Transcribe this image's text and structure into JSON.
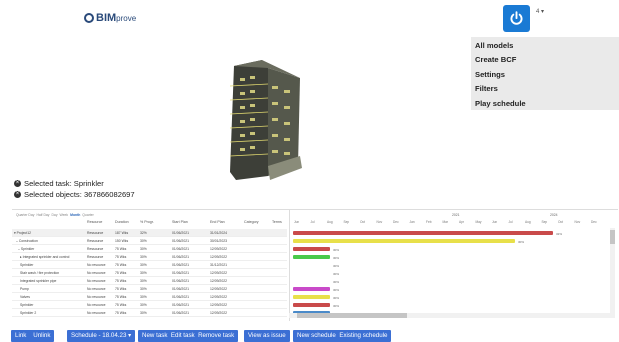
{
  "header": {
    "logo_main": "BIM",
    "logo_sub": "prove",
    "user_caret": "4 ▾"
  },
  "side_menu": {
    "items": [
      "All models",
      "Create BCF",
      "Settings",
      "Filters",
      "Play schedule"
    ]
  },
  "selection": {
    "task_label": "Selected task: Sprinkler",
    "objects_label": "Selected objects: 367866082697"
  },
  "gantt": {
    "view_modes": [
      "Quarter Day",
      "Half Day",
      "Day",
      "Week",
      "Month",
      "Quarter"
    ],
    "active_view": "Month",
    "columns": [
      "Resource",
      "Duration",
      "% Progr.",
      "Start Plan",
      "End Plan",
      "Category",
      "Terms"
    ],
    "rows": [
      {
        "name": "▾ Project12",
        "resource": "Ressource",
        "duration": "187 Wks",
        "progress": "32%",
        "start": "01/06/2021",
        "end": "31/01/2024"
      },
      {
        "name": "– Construction",
        "resource": "Ressource",
        "duration": "150 Wks",
        "progress": "30%",
        "start": "01/06/2021",
        "end": "30/01/2023"
      },
      {
        "name": "– Sprinkler",
        "resource": "Ressource",
        "duration": "75 Wks",
        "progress": "30%",
        "start": "01/06/2021",
        "end": "12/09/2022"
      },
      {
        "name": "▸ Integrated sprinkler and control",
        "resource": "Ressource",
        "duration": "75 Wks",
        "progress": "30%",
        "start": "01/06/2021",
        "end": "12/09/2022"
      },
      {
        "name": "Sprinkler",
        "resource": "No resource",
        "duration": "75 Wks",
        "progress": "30%",
        "start": "01/06/2021",
        "end": "31/12/2021"
      },
      {
        "name": "Stair wash / fire protection",
        "resource": "No resource",
        "duration": "75 Wks",
        "progress": "30%",
        "start": "01/06/2021",
        "end": "12/09/2022"
      },
      {
        "name": "Integrated sprinkler pipe",
        "resource": "No resource",
        "duration": "75 Wks",
        "progress": "30%",
        "start": "01/06/2021",
        "end": "12/09/2022"
      },
      {
        "name": "Pump",
        "resource": "No resource",
        "duration": "75 Wks",
        "progress": "30%",
        "start": "01/06/2021",
        "end": "12/09/2022"
      },
      {
        "name": "Valves",
        "resource": "No resource",
        "duration": "75 Wks",
        "progress": "30%",
        "start": "01/06/2021",
        "end": "12/09/2022"
      },
      {
        "name": "Sprinkler",
        "resource": "No resource",
        "duration": "75 Wks",
        "progress": "30%",
        "start": "01/06/2021",
        "end": "12/09/2022"
      },
      {
        "name": "Sprinkler 2",
        "resource": "No resource",
        "duration": "75 Wks",
        "progress": "30%",
        "start": "01/06/2021",
        "end": "12/09/2022"
      }
    ],
    "years": [
      "2021",
      "2024"
    ],
    "months": [
      "Jun",
      "Jul",
      "Aug",
      "Sep",
      "Oct",
      "Nov",
      "Dec",
      "Jan",
      "Feb",
      "Mar",
      "Apr",
      "May",
      "Jun",
      "Jul",
      "Aug",
      "Sep",
      "Oct",
      "Nov",
      "Dec"
    ],
    "bars": [
      {
        "color": "#c94a4a",
        "pct": "32%"
      },
      {
        "color": "#e8e04a",
        "pct": "30%"
      },
      {
        "color": "#c94a4a",
        "pct": "30%"
      },
      {
        "color": "#4ac94a",
        "pct": "30%"
      },
      {
        "color": "",
        "pct": "30%"
      },
      {
        "color": "",
        "pct": "30%"
      },
      {
        "color": "",
        "pct": "30%"
      },
      {
        "color": "#c94ac9",
        "pct": "30%"
      },
      {
        "color": "#e8e04a",
        "pct": "30%"
      },
      {
        "color": "#c94a4a",
        "pct": "30%"
      },
      {
        "color": "#4a8ac9",
        "pct": "30%"
      }
    ]
  },
  "toolbar": {
    "link": "Link",
    "unlink": "Unlink",
    "schedule": "Schedule - 18.04.23 ▾",
    "new_task": "New task",
    "edit_task": "Edit task",
    "remove_task": "Remove task",
    "view_as_issue": "View as issue",
    "new_schedule": "New schedule",
    "existing_schedule": "Existing schedule"
  },
  "colors": {
    "accent": "#3b6fd4",
    "power": "#1a7ad4",
    "logo": "#2a4a7a"
  }
}
